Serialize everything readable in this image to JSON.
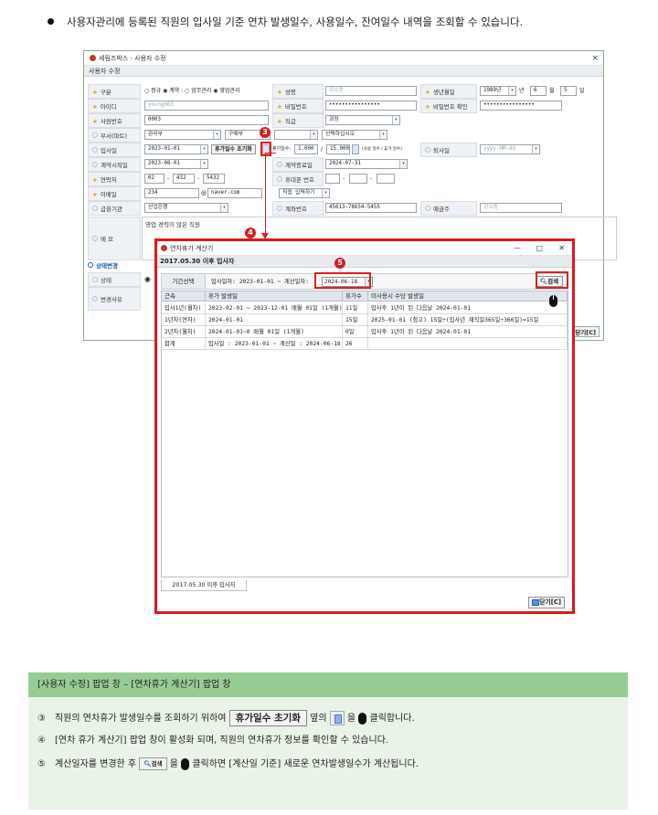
{
  "intro": "사용자관리에 등록된 직원의 입사일 기준 연차 발생일수, 사용일수, 잔여일수 내역을 조회할 수 있습니다.",
  "base_window": {
    "title": "세림즈박스 - 사용자 수정",
    "subtitle": "사용자 수정",
    "close": "×",
    "fields": {
      "gubun_label": "구분",
      "gubun_options": [
        "정규",
        "계약",
        "업무관리",
        "영업관리"
      ],
      "gubun_text": "○ 정규  ◉ 계약  :  ○ 업무관리  ◉ 영업관리",
      "name_label": "성명",
      "name_value": "강소동",
      "birth_label": "생년월일",
      "birth_year": "1989년",
      "birth_nyeon": "년",
      "birth_month": "6",
      "birth_wol": "월",
      "birth_day": "5",
      "birth_il": "일",
      "id_label": "아이디",
      "id_value": "young003",
      "pw_label": "비밀번호",
      "pw_value": "••••••••••••••••",
      "pw_confirm_label": "비밀번호 확인",
      "pw_confirm_value": "••••••••••••••••",
      "emp_no_label": "사원번호",
      "emp_no_value": "0003",
      "rank_label": "직급",
      "rank_value": "과장",
      "dept_label": "부서(파트)",
      "dept_value": "관리부",
      "part_value": "구매부",
      "select_placeholder": "선택하십시오",
      "join_label": "입사일",
      "join_value": "2023-01-01",
      "reset_btn": "휴가일수 초기화",
      "leave_days_label": "휴가일수:",
      "leave_used": "1.000",
      "slash": "/",
      "leave_total": "15.000",
      "leave_note": "(사용 일수 / 휴가 일수)",
      "retire_label": "퇴사일",
      "retire_placeholder": "yyyy-MM-dd",
      "contract_start_label": "계약시작일",
      "contract_start_value": "2023-08-01",
      "contract_end_label": "계약종료일",
      "contract_end_value": "2024-07-31",
      "phone_label": "연락처",
      "phone_1": "02",
      "phone_2": "432",
      "phone_3": "5432",
      "dash": "-",
      "mobile_label": "휴대폰 번호",
      "email_label": "이메일",
      "email_id": "234",
      "at": "@",
      "email_domain": "naver.com",
      "email_direct": "직접 입력하기",
      "bank_label": "급융기관",
      "bank_value": "산업은행",
      "account_label": "계좌번호",
      "account_value": "45613-78654-5455",
      "holder_label": "예금주",
      "holder_value": "강소동",
      "memo_label": "메 모",
      "memo_value": "영업 경력이 많은 직원",
      "status_section": "상태변경",
      "status_label": "상태",
      "change_reason_label": "변경사유",
      "close_btn": "닫기[C]"
    }
  },
  "popup": {
    "title": "연차휴가 계산기",
    "min": "—",
    "max": "□",
    "close": "✕",
    "subtitle": "2017.05.30 이후 입사자",
    "filter_label": "기간선택",
    "filter_text": "입사일자: 2023-01-01 ~ 계산일자:",
    "calc_date": "2024-06-18",
    "search_btn": "검색",
    "columns": [
      "근속",
      "휴가 발생일",
      "휴가수",
      "미사용시 수당 발생일"
    ],
    "rows": [
      [
        "입사1년(월차)",
        "2023-02-01 ~ 2023-12-01 매월 01일 (1개월)",
        "11일",
        "입사후 1년이 된 다음날 2024-01-01"
      ],
      [
        "1년차(연차)",
        "2024-01-01",
        "15일",
        "2025-01-01 (참고) 15일÷(입사년 재직일365일÷366일)=15일"
      ],
      [
        "2년차(월차)",
        "2024-01-01~0 매월 01일 (1개월)",
        "0일",
        "입사후 1년이 된 다음날 2024-01-01"
      ],
      [
        "합계",
        "입사일 : 2023-01-01 ~ 계산일 : 2024-06-18",
        "26",
        ""
      ]
    ],
    "tab_label": "2017.05.30 이후 입사자",
    "close_btn": "닫기[C]"
  },
  "badges": {
    "b3": "3",
    "b4": "4",
    "b5": "5"
  },
  "instructions": {
    "header": "[사용자 수정] 팝업 창 – [연차휴가 계산기] 팝업 창",
    "s3_num": "③",
    "s3_a": "직원의 연차휴가 발생일수를 조회하기 위하여",
    "s3_btn": "휴가일수 초기화",
    "s3_b": "옆의",
    "s3_c": "을",
    "s3_d": "클릭합니다.",
    "s4_num": "④",
    "s4_text": "[연차 휴가 계산기] 팝업 창이 활성화 되며, 직원의 연차휴가 정보를 확인할 수 있습니다.",
    "s5_num": "⑤",
    "s5_a": "계산일자를 변경한 후",
    "s5_btn": "검색",
    "s5_b": "을",
    "s5_c": "클릭하면 [계산일 기준] 새로운 연차발생일수가 계산됩니다."
  },
  "colors": {
    "accent_red": "#e01818",
    "panel_header": "#98cc95",
    "panel_bg": "#eaf3e8"
  }
}
